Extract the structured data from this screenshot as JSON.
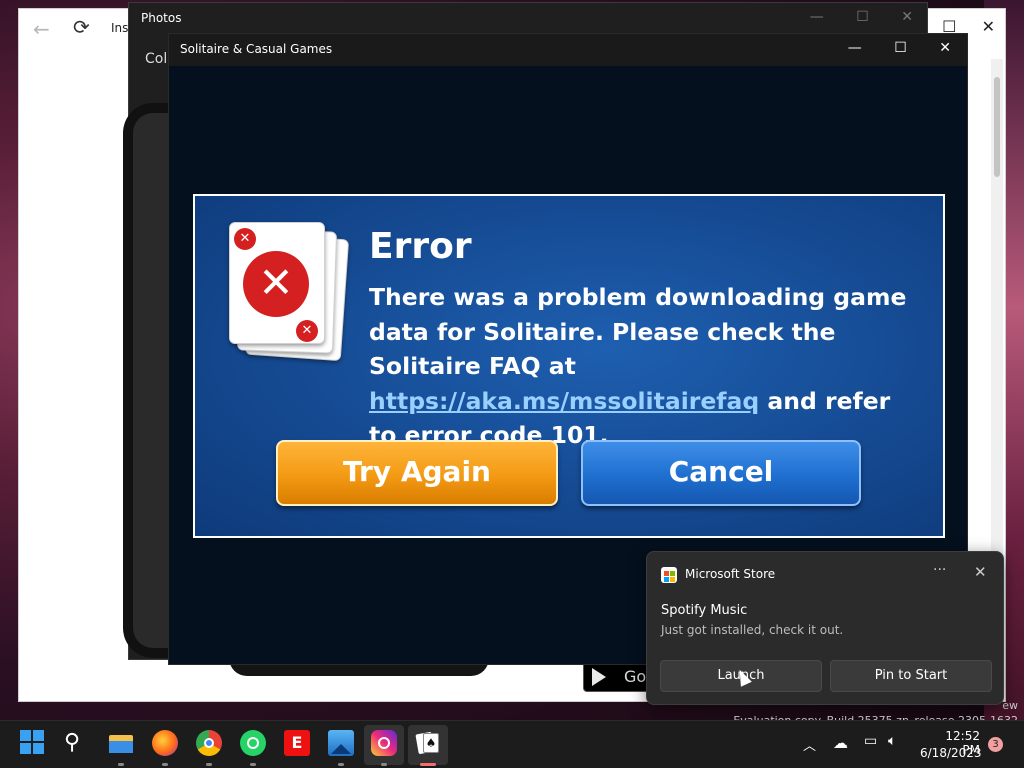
{
  "back_window": {
    "tab_partial": "Ins",
    "eval_text": "ew\nEvaluation copy. Build 25375.zn_release.2305-1632"
  },
  "photos_window": {
    "title": "Photos",
    "collections_partial": "Coll",
    "google_play_partial": "Go"
  },
  "solitaire_window": {
    "title": "Solitaire & Casual Games",
    "error": {
      "title": "Error",
      "message_before_link": "There was a problem downloading game data for Solitaire. Please check the Solitaire FAQ at ",
      "link": "https://aka.ms/mssolitairefaq",
      "message_after_link": " and refer to error code 101.",
      "try_again_label": "Try Again",
      "cancel_label": "Cancel"
    }
  },
  "toast": {
    "app_name": "Microsoft Store",
    "more_glyph": "···",
    "close_glyph": "✕",
    "heading": "Spotify Music",
    "message": "Just got installed, check it out.",
    "launch_label": "Launch",
    "pin_label": "Pin to Start"
  },
  "taskbar": {
    "icons": [
      "start-icon",
      "search-icon",
      "file-explorer-icon",
      "firefox-icon",
      "chrome-icon",
      "whatsapp-icon",
      "espn-icon",
      "photos-icon",
      "instagram-icon",
      "solitaire-icon"
    ],
    "time": "12:52 PM",
    "date": "6/18/2023",
    "notification_count": "3"
  },
  "colors": {
    "error_panel": "#154a92",
    "try_again": "#f39a14",
    "cancel": "#1f6fd0",
    "link": "#9ad0ff"
  }
}
